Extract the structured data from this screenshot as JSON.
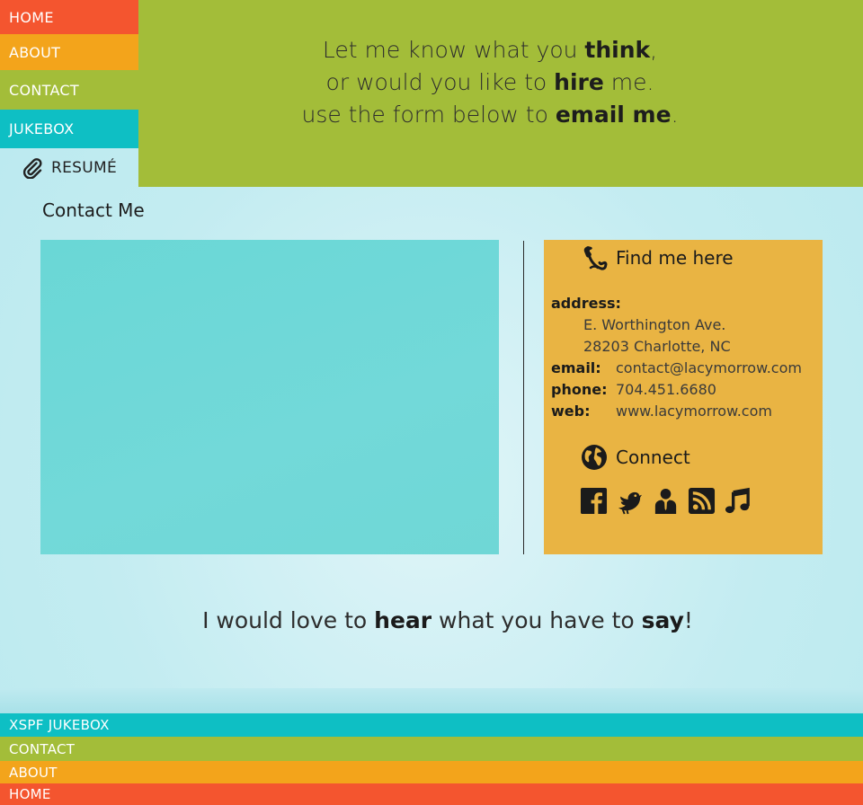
{
  "nav": {
    "home": "HOME",
    "about": "ABOUT",
    "contact": "CONTACT",
    "jukebox": "JUKEBOX",
    "resume": "RESUMÉ"
  },
  "banner": {
    "line1_pre": "Let me know what you ",
    "line1_bold": "think",
    "line1_post": ",",
    "line2_pre": "or would you like to ",
    "line2_bold": "hire",
    "line2_post": " me.",
    "line3_pre": "use the form below to ",
    "line3_bold": "email me",
    "line3_post": "."
  },
  "contact": {
    "title": "Contact Me"
  },
  "info": {
    "find_heading": "Find me here",
    "address_label": "address:",
    "address_line1": "E. Worthington Ave.",
    "address_line2": "28203 Charlotte, NC",
    "email_label": "email:",
    "email_value": "contact@lacymorrow.com",
    "phone_label": "phone:",
    "phone_value": "704.451.6680",
    "web_label": "web:",
    "web_value": "www.lacymorrow.com",
    "connect_heading": "Connect",
    "social_icons": [
      "facebook-icon",
      "twitter-bird-icon",
      "profile-icon",
      "rss-icon",
      "music-note-icon"
    ]
  },
  "tagline": {
    "pre": "I would love to ",
    "bold1": "hear",
    "mid": " what you have to ",
    "bold2": "say",
    "post": "!"
  },
  "footer": {
    "jukebox": "XSPF JUKEBOX",
    "contact": "CONTACT",
    "about": "ABOUT",
    "home": "HOME"
  },
  "colors": {
    "home": "#f4552f",
    "about": "#f3a41b",
    "contact": "#a3bd39",
    "jukebox": "#0ebfc4",
    "info_box": "#e9b443",
    "form_box": "#6ad7d6"
  }
}
